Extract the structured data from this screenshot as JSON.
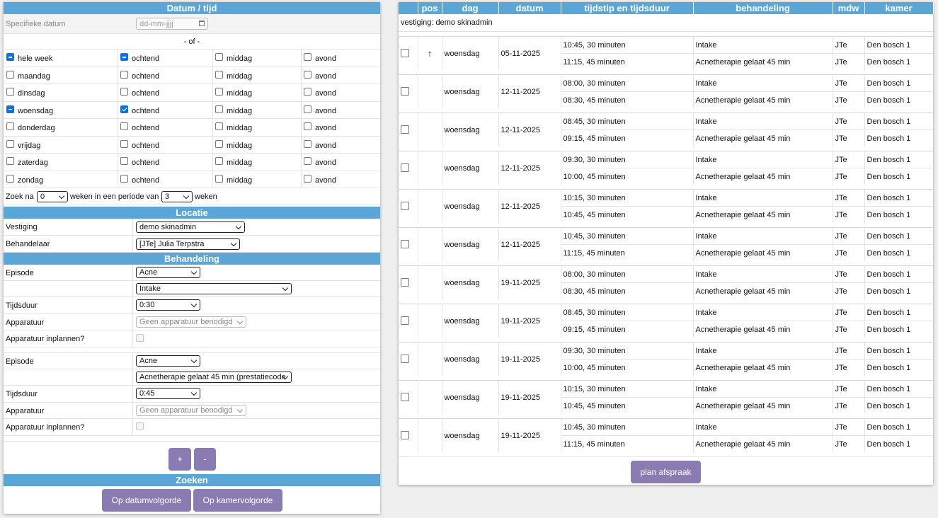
{
  "datetime": {
    "section_title": "Datum / tijd",
    "specific_date_label": "Specifieke datum",
    "date_placeholder": "dd-mm-jjjj",
    "or_label": "- of -",
    "days": [
      {
        "label": "hele week",
        "all_state": "indeterminate",
        "morning": "indeterminate"
      },
      {
        "label": "maandag",
        "all_state": "unchecked",
        "morning": "unchecked"
      },
      {
        "label": "dinsdag",
        "all_state": "unchecked",
        "morning": "unchecked"
      },
      {
        "label": "woensdag",
        "all_state": "indeterminate",
        "morning": "checked"
      },
      {
        "label": "donderdag",
        "all_state": "unchecked",
        "morning": "unchecked"
      },
      {
        "label": "vrijdag",
        "all_state": "unchecked",
        "morning": "unchecked"
      },
      {
        "label": "zaterdag",
        "all_state": "unchecked",
        "morning": "unchecked"
      },
      {
        "label": "zondag",
        "all_state": "unchecked",
        "morning": "unchecked"
      }
    ],
    "morning_label": "ochtend",
    "afternoon_label": "middag",
    "evening_label": "avond",
    "search_prefix": "Zoek na",
    "weeks_after_value": "0",
    "search_middle": "weken in een periode van",
    "period_value": "3",
    "search_suffix": "weken"
  },
  "location": {
    "section_title": "Locatie",
    "branch_label": "Vestiging",
    "branch_value": "demo skinadmin",
    "practitioner_label": "Behandelaar",
    "practitioner_value": "[JTe] Julia Terpstra"
  },
  "treatment": {
    "section_title": "Behandeling",
    "blocks": [
      {
        "episode_label": "Episode",
        "episode_value": "Acne",
        "treatment_value": "Intake",
        "duration_label": "Tijdsduur",
        "duration_value": "0:30",
        "equipment_label": "Apparatuur",
        "equipment_value": "Geen apparatuur benodigd",
        "plan_equipment_label": "Apparatuur inplannen?"
      },
      {
        "episode_label": "Episode",
        "episode_value": "Acne",
        "treatment_value": "Acnetherapie gelaat 45 min (prestatiecode",
        "duration_label": "Tijdsduur",
        "duration_value": "0:45",
        "equipment_label": "Apparatuur",
        "equipment_value": "Geen apparatuur benodigd",
        "plan_equipment_label": "Apparatuur inplannen?"
      }
    ],
    "add_label": "+",
    "remove_label": "-"
  },
  "search": {
    "section_title": "Zoeken",
    "by_date_label": "Op datumvolgorde",
    "by_room_label": "Op kamervolgorde"
  },
  "results": {
    "headers": [
      "",
      "pos",
      "dag",
      "datum",
      "tijdstip en tijdsduur",
      "behandeling",
      "mdw",
      "kamer"
    ],
    "branch_line": "vestiging: demo skinadmin",
    "groups": [
      {
        "pos": "↑",
        "day": "woensdag",
        "date": "05-11-2025",
        "slots": [
          {
            "time": "10:45, 30 minuten",
            "treatment": "Intake",
            "staff": "JTe",
            "room": "Den bosch 1"
          },
          {
            "time": "11:15, 45 minuten",
            "treatment": "Acnetherapie gelaat 45 min",
            "staff": "JTe",
            "room": "Den bosch 1"
          }
        ]
      },
      {
        "pos": "",
        "day": "woensdag",
        "date": "12-11-2025",
        "slots": [
          {
            "time": "08:00, 30 minuten",
            "treatment": "Intake",
            "staff": "JTe",
            "room": "Den bosch 1"
          },
          {
            "time": "08:30, 45 minuten",
            "treatment": "Acnetherapie gelaat 45 min",
            "staff": "JTe",
            "room": "Den bosch 1"
          }
        ]
      },
      {
        "pos": "",
        "day": "woensdag",
        "date": "12-11-2025",
        "slots": [
          {
            "time": "08:45, 30 minuten",
            "treatment": "Intake",
            "staff": "JTe",
            "room": "Den bosch 1"
          },
          {
            "time": "09:15, 45 minuten",
            "treatment": "Acnetherapie gelaat 45 min",
            "staff": "JTe",
            "room": "Den bosch 1"
          }
        ]
      },
      {
        "pos": "",
        "day": "woensdag",
        "date": "12-11-2025",
        "slots": [
          {
            "time": "09:30, 30 minuten",
            "treatment": "Intake",
            "staff": "JTe",
            "room": "Den bosch 1"
          },
          {
            "time": "10:00, 45 minuten",
            "treatment": "Acnetherapie gelaat 45 min",
            "staff": "JTe",
            "room": "Den bosch 1"
          }
        ]
      },
      {
        "pos": "",
        "day": "woensdag",
        "date": "12-11-2025",
        "slots": [
          {
            "time": "10:15, 30 minuten",
            "treatment": "Intake",
            "staff": "JTe",
            "room": "Den bosch 1"
          },
          {
            "time": "10:45, 45 minuten",
            "treatment": "Acnetherapie gelaat 45 min",
            "staff": "JTe",
            "room": "Den bosch 1"
          }
        ]
      },
      {
        "pos": "",
        "day": "woensdag",
        "date": "12-11-2025",
        "slots": [
          {
            "time": "10:45, 30 minuten",
            "treatment": "Intake",
            "staff": "JTe",
            "room": "Den bosch 1"
          },
          {
            "time": "11:15, 45 minuten",
            "treatment": "Acnetherapie gelaat 45 min",
            "staff": "JTe",
            "room": "Den bosch 1"
          }
        ]
      },
      {
        "pos": "",
        "day": "woensdag",
        "date": "19-11-2025",
        "slots": [
          {
            "time": "08:00, 30 minuten",
            "treatment": "Intake",
            "staff": "JTe",
            "room": "Den bosch 1"
          },
          {
            "time": "08:30, 45 minuten",
            "treatment": "Acnetherapie gelaat 45 min",
            "staff": "JTe",
            "room": "Den bosch 1"
          }
        ]
      },
      {
        "pos": "",
        "day": "woensdag",
        "date": "19-11-2025",
        "slots": [
          {
            "time": "08:45, 30 minuten",
            "treatment": "Intake",
            "staff": "JTe",
            "room": "Den bosch 1"
          },
          {
            "time": "09:15, 45 minuten",
            "treatment": "Acnetherapie gelaat 45 min",
            "staff": "JTe",
            "room": "Den bosch 1"
          }
        ]
      },
      {
        "pos": "",
        "day": "woensdag",
        "date": "19-11-2025",
        "slots": [
          {
            "time": "09:30, 30 minuten",
            "treatment": "Intake",
            "staff": "JTe",
            "room": "Den bosch 1"
          },
          {
            "time": "10:00, 45 minuten",
            "treatment": "Acnetherapie gelaat 45 min",
            "staff": "JTe",
            "room": "Den bosch 1"
          }
        ]
      },
      {
        "pos": "",
        "day": "woensdag",
        "date": "19-11-2025",
        "slots": [
          {
            "time": "10:15, 30 minuten",
            "treatment": "Intake",
            "staff": "JTe",
            "room": "Den bosch 1"
          },
          {
            "time": "10:45, 45 minuten",
            "treatment": "Acnetherapie gelaat 45 min",
            "staff": "JTe",
            "room": "Den bosch 1"
          }
        ]
      },
      {
        "pos": "",
        "day": "woensdag",
        "date": "19-11-2025",
        "slots": [
          {
            "time": "10:45, 30 minuten",
            "treatment": "Intake",
            "staff": "JTe",
            "room": "Den bosch 1"
          },
          {
            "time": "11:15, 45 minuten",
            "treatment": "Acnetherapie gelaat 45 min",
            "staff": "JTe",
            "room": "Den bosch 1"
          }
        ]
      }
    ],
    "plan_label": "plan afspraak"
  },
  "colors": {
    "header": "#5aa6d6",
    "button": "#8b7bb3",
    "checkbox": "#0a72e6"
  },
  "icons": {
    "calendar": "calendar-icon",
    "arrow": "arrow-up-icon"
  }
}
